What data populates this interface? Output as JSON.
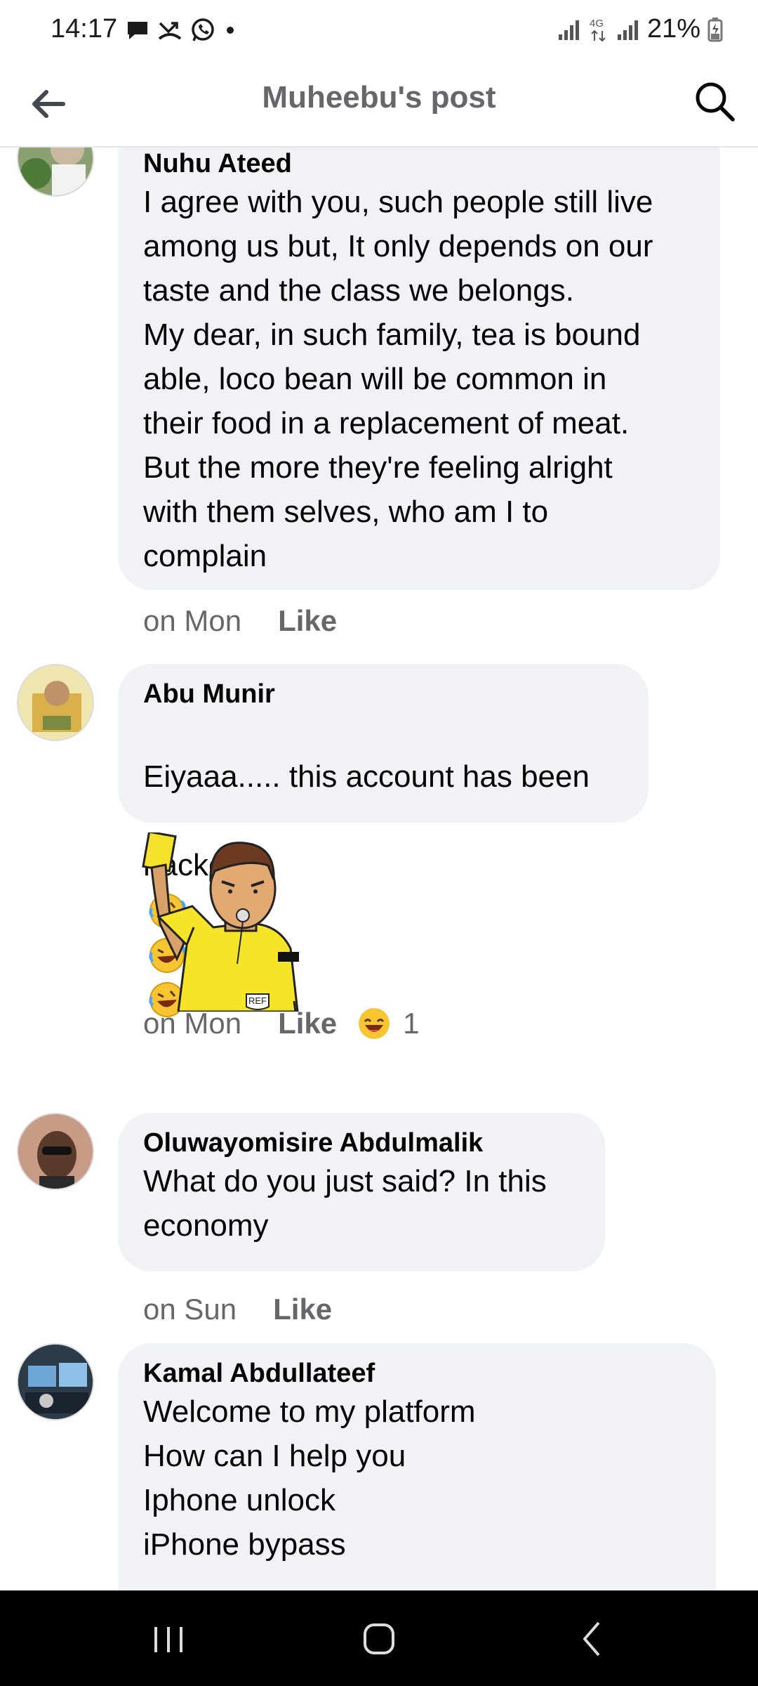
{
  "status_bar": {
    "time": "14:17",
    "network": "4G",
    "battery": "21%"
  },
  "header": {
    "title": "Muheebu's post"
  },
  "comments": [
    {
      "author": "Nuhu Ateed",
      "text": "I agree with you, such people still live\namong us but, It only depends on our\ntaste and the class we belongs.\nMy dear, in such family, tea is bound\nable, loco bean will be common in\ntheir food in a replacement of meat.\nBut the more they're feeling alright\nwith them selves, who am I to\ncomplain",
      "time": "on Mon",
      "like": "Like"
    },
    {
      "author": "Abu Munir",
      "text_line1": "Eiyaaa..... this account has been",
      "text_line2": "hacked",
      "emojis": [
        "rofl-emoji",
        "rofl-emoji",
        "rofl-emoji"
      ],
      "sticker": "referee-yellow-card-sticker",
      "sticker_badge": "REF",
      "time": "on Mon",
      "like": "Like",
      "reaction": "haha-emoji",
      "reaction_count": "1"
    },
    {
      "author": "Oluwayomisire Abdulmalik",
      "text": "What do you just said? In this\neconomy",
      "time": "on Sun",
      "like": "Like"
    },
    {
      "author": "Kamal Abdullateef",
      "text": "Welcome to my platform\nHow can I help you\nIphone unlock\niPhone bypass"
    }
  ],
  "colors": {
    "bubble": "#f0f2f5",
    "meta_text": "#65676b",
    "header_title": "#65676b"
  }
}
